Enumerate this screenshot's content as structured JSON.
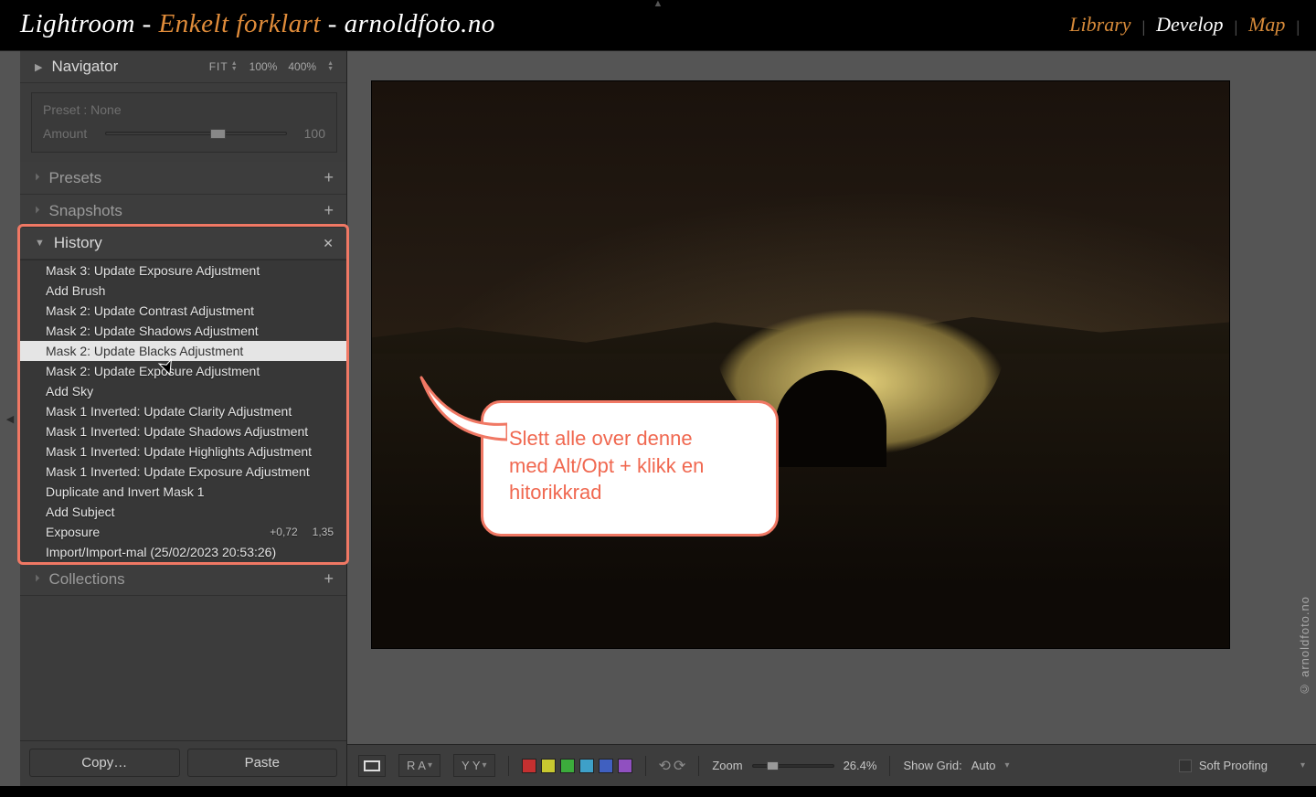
{
  "title": {
    "p1": "Lightroom - ",
    "p2": "Enkelt forklart",
    "p3": " - arnoldfoto.no"
  },
  "nav": {
    "library": "Library",
    "develop": "Develop",
    "map": "Map"
  },
  "navigator": {
    "label": "Navigator",
    "fit": "FIT",
    "p100": "100%",
    "p400": "400%"
  },
  "presetBox": {
    "preset": "Preset : None",
    "amountLabel": "Amount",
    "amountValue": "100"
  },
  "panels": {
    "presets": "Presets",
    "snapshots": "Snapshots",
    "history": "History",
    "collections": "Collections"
  },
  "history": [
    {
      "label": "Mask 3: Update Exposure Adjustment"
    },
    {
      "label": "Add Brush"
    },
    {
      "label": "Mask 2: Update Contrast Adjustment"
    },
    {
      "label": "Mask 2: Update Shadows Adjustment"
    },
    {
      "label": "Mask 2: Update Blacks Adjustment",
      "selected": true
    },
    {
      "label": "Mask 2: Update Exposure Adjustment"
    },
    {
      "label": "Add Sky"
    },
    {
      "label": "Mask 1 Inverted: Update Clarity Adjustment"
    },
    {
      "label": "Mask 1 Inverted: Update Shadows Adjustment"
    },
    {
      "label": "Mask 1 Inverted: Update Highlights Adjustment"
    },
    {
      "label": "Mask 1 Inverted: Update Exposure Adjustment"
    },
    {
      "label": "Duplicate and Invert Mask 1"
    },
    {
      "label": "Add Subject"
    },
    {
      "label": "Exposure",
      "v1": "+0,72",
      "v2": "1,35"
    },
    {
      "label": "Import/Import-mal (25/02/2023 20:53:26)"
    }
  ],
  "buttons": {
    "copy": "Copy…",
    "paste": "Paste"
  },
  "toolbar": {
    "ra": "R A",
    "yy": "Y Y",
    "zoomLabel": "Zoom",
    "zoomValue": "26.4%",
    "gridLabel": "Show Grid:",
    "gridValue": "Auto",
    "proof": "Soft Proofing",
    "swatches": [
      "#c53030",
      "#c8c830",
      "#3cac3c",
      "#3ea0c8",
      "#4060c0",
      "#9050c0"
    ]
  },
  "callout": {
    "line1": "Slett alle over denne",
    "line2": "med Alt/Opt + klikk en",
    "line3": "hitorikkrad"
  },
  "watermark": "© arnoldfoto.no"
}
